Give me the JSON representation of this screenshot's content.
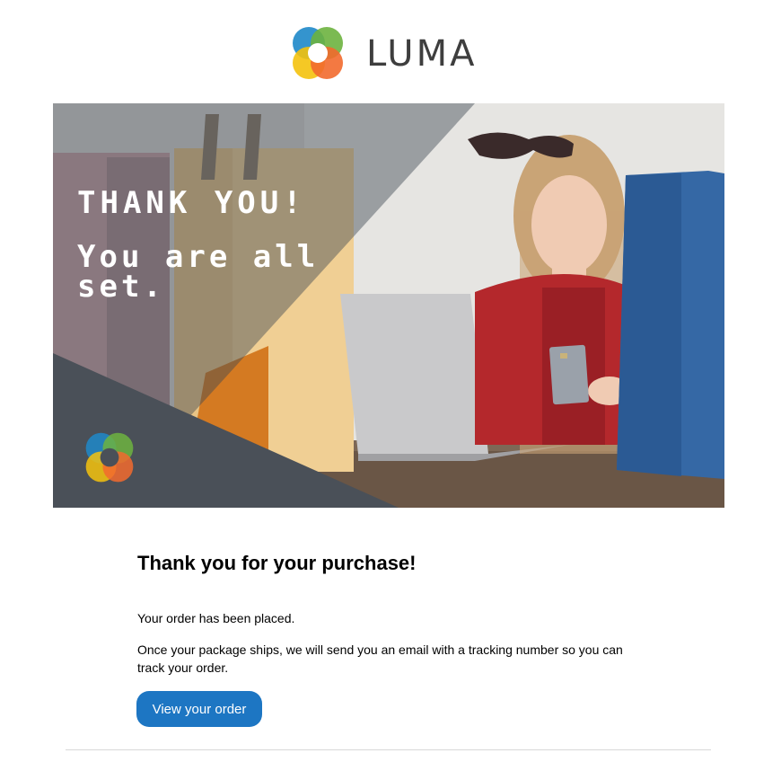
{
  "header": {
    "brand_name": "LUMA",
    "logo_icon": "luma-logo-icon"
  },
  "hero": {
    "line1": "THANK YOU!",
    "line2": "You are all set.",
    "image": "woman-shopping-online-photo",
    "logo_icon": "luma-logo-icon"
  },
  "content": {
    "heading": "Thank you for your purchase!",
    "paragraph1": "Your order has been placed.",
    "paragraph2": "Once your package ships, we will send you an email with a tracking number so you can track your order.",
    "button_label": "View your order"
  },
  "colors": {
    "button": "#1d76c3",
    "brand_text": "#3e3e3e",
    "hero_overlay": "#4a5058",
    "logo_green": "#6db33f",
    "logo_blue": "#1e88c9",
    "logo_orange": "#f26a2e",
    "logo_yellow": "#f4c20d"
  }
}
